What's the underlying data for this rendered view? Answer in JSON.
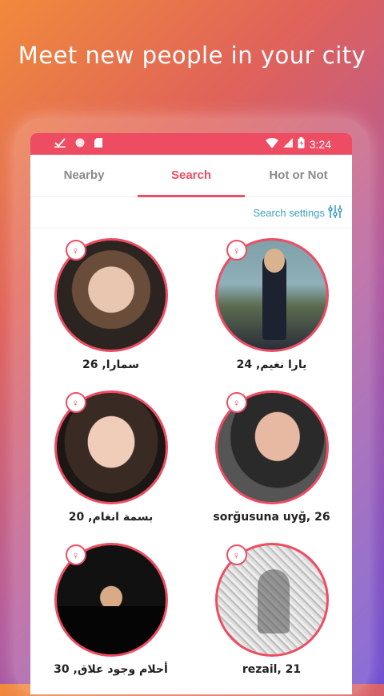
{
  "headline": "Meet new people in your city",
  "status_bar": {
    "time": "3:24"
  },
  "tabs": [
    {
      "label": "Nearby",
      "active": false
    },
    {
      "label": "Search",
      "active": true
    },
    {
      "label": "Hot or Not",
      "active": false
    }
  ],
  "search_settings": {
    "label": "Search settings",
    "icon": "sliders-icon"
  },
  "profiles": [
    {
      "name": "سمارا, 26",
      "gender_icon": "female-icon"
    },
    {
      "name": "يارا نغيم, 24",
      "gender_icon": "female-icon"
    },
    {
      "name": "بسمة انغام, 20",
      "gender_icon": "female-icon"
    },
    {
      "name": "sorğusuna uyğ, 26",
      "gender_icon": "female-icon"
    },
    {
      "name": "أحلام وجود علاق, 30",
      "gender_icon": "female-icon"
    },
    {
      "name": "rezail, 21",
      "gender_icon": "female-icon"
    }
  ],
  "colors": {
    "accent": "#ee4c62",
    "link": "#3da0c6",
    "inactive_tab": "#8a8a8a"
  }
}
